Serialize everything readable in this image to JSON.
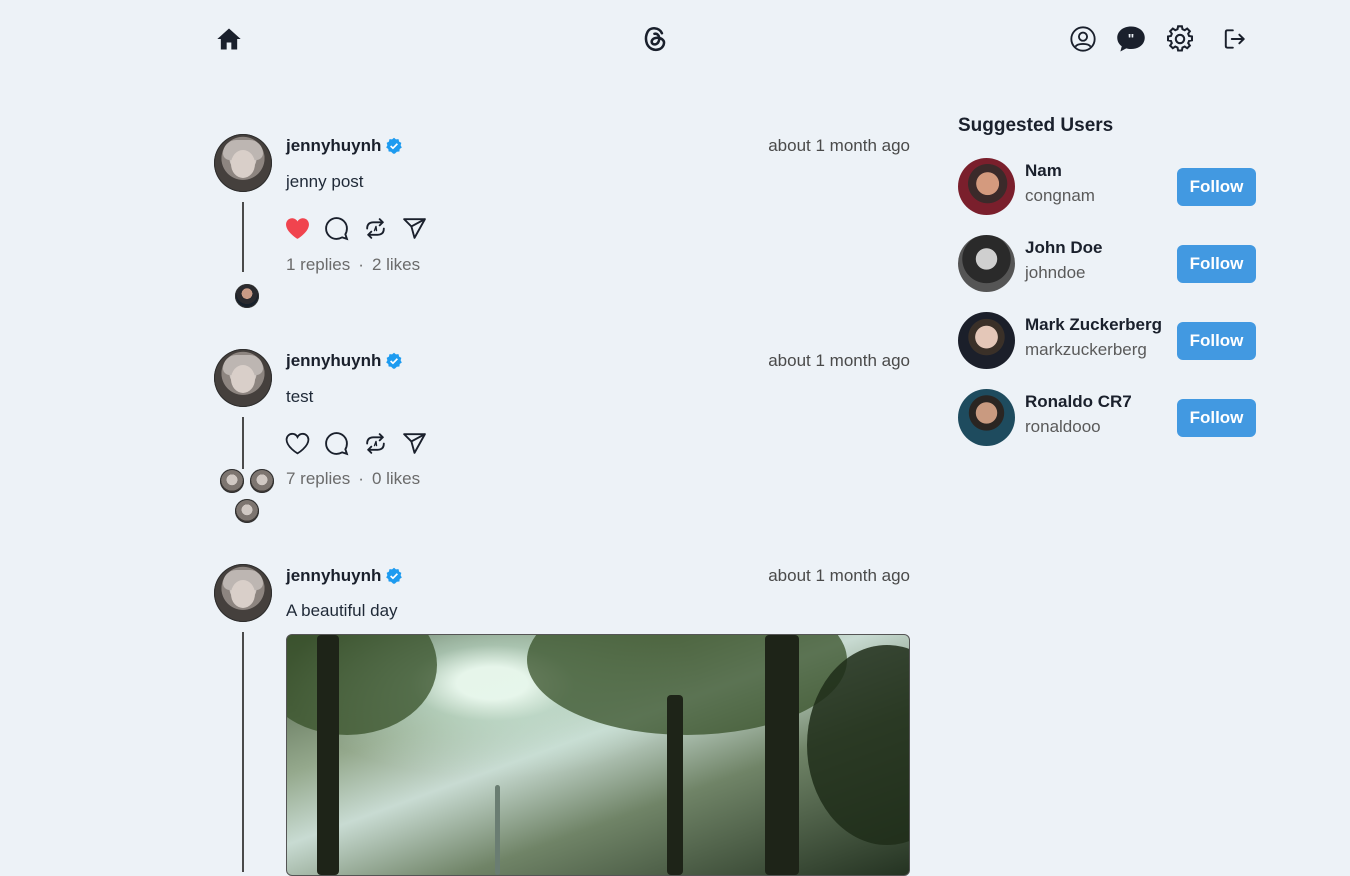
{
  "header": {
    "home_icon": "home-icon",
    "logo_icon": "threads-logo-icon",
    "profile_icon": "user-circle-icon",
    "chat_icon": "chat-quote-icon",
    "settings_icon": "gear-icon",
    "logout_icon": "logout-icon"
  },
  "posts": [
    {
      "username": "jennyhuynh",
      "time": "about 1 month ago",
      "text": "jenny post",
      "liked": true,
      "replies_text": "1 replies",
      "likes_text": "2 likes",
      "separator": "·"
    },
    {
      "username": "jennyhuynh",
      "time": "about 1 month ago",
      "text": "test",
      "liked": false,
      "replies_text": "7 replies",
      "likes_text": "0 likes",
      "separator": "·"
    },
    {
      "username": "jennyhuynh",
      "time": "about 1 month ago",
      "text": "A beautiful day",
      "has_image": true
    }
  ],
  "sidebar": {
    "title": "Suggested Users",
    "users": [
      {
        "name": "Nam",
        "handle": "congnam",
        "button": "Follow"
      },
      {
        "name": "John Doe",
        "handle": "johndoe",
        "button": "Follow"
      },
      {
        "name": "Mark Zuckerberg",
        "handle": "markzuckerberg",
        "button": "Follow"
      },
      {
        "name": "Ronaldo CR7",
        "handle": "ronaldooo",
        "button": "Follow"
      }
    ]
  },
  "colors": {
    "background": "#edf2f7",
    "accent": "#4299e1",
    "like": "#f0444e",
    "verified": "#1d9bf0"
  }
}
